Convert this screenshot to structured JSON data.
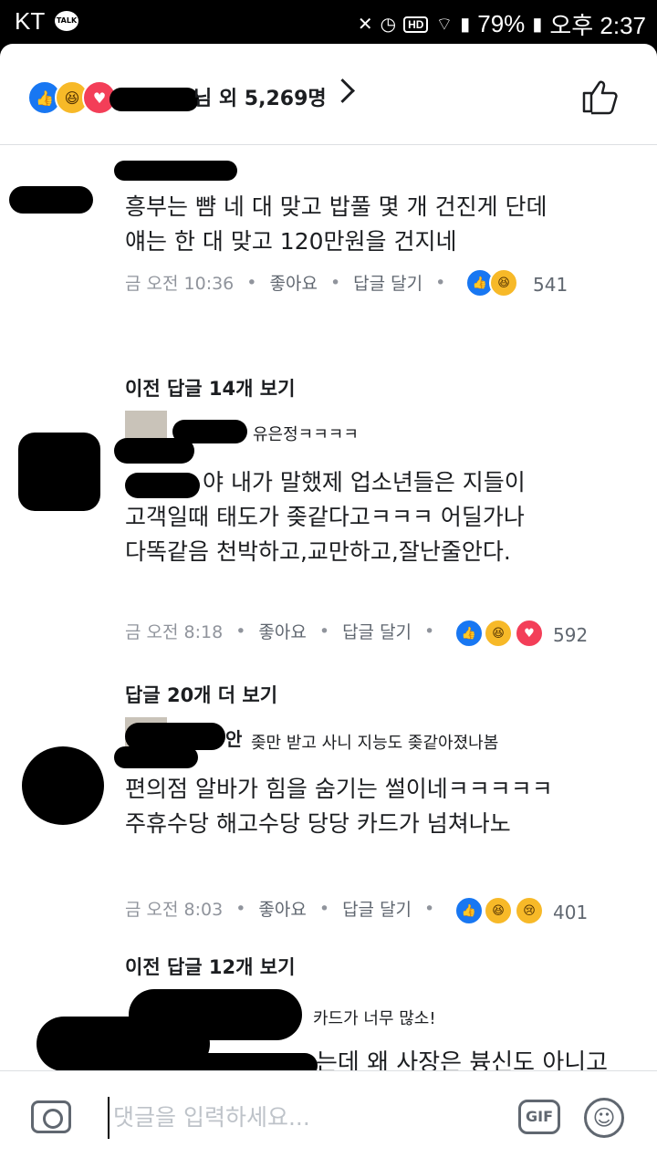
{
  "status": {
    "carrier": "KT",
    "talk_label": "TALK",
    "hd_label": "HD",
    "battery": "79%",
    "time": "오후 2:37"
  },
  "header": {
    "reactors_suffix": "님 외 5,269명"
  },
  "comments": [
    {
      "text": "흥부는 뺨 네 대 맞고 밥풀 몇 개 건진게 단데\n얘는 한 대 맞고 120만원을 건지네",
      "time": "금 오전 10:36",
      "like": "좋아요",
      "reply": "답글 달기",
      "reaction_count": "541",
      "reactions": [
        "like",
        "haha"
      ],
      "prev_replies": "이전 답글 14개 보기",
      "reply_text": "유은정ㅋㅋㅋㅋ"
    },
    {
      "text_lead": "야 내가 말했제 업소년들은 지들이",
      "text": "고객일때 태도가 좆같다고ㅋㅋㅋ 어딜가나\n다똑같음 천박하고,교만하고,잘난줄안다.",
      "time": "금 오전 8:18",
      "like": "좋아요",
      "reply": "답글 달기",
      "reaction_count": "592",
      "reactions": [
        "like",
        "haha",
        "love"
      ],
      "prev_replies": "답글 20개 더 보기",
      "reply_text": "좆만 받고 사니 지능도 좆같아졌나봄",
      "reply_name_tail": "안"
    },
    {
      "text": "편의점 알바가 힘을 숨기는 썰이네ㅋㅋㅋㅋㅋ\n주휴수당 해고수당 당당 카드가 넘쳐나노",
      "time": "금 오전 8:03",
      "like": "좋아요",
      "reply": "답글 달기",
      "reaction_count": "401",
      "reactions": [
        "like",
        "haha",
        "sad"
      ],
      "prev_replies": "이전 답글 12개 보기",
      "reply_text": "카드가 너무 많소!"
    },
    {
      "text": "는데 왜 사장은 븅신도 아니고"
    }
  ],
  "composer": {
    "placeholder": "댓글을 입력하세요...",
    "gif_label": "GIF"
  }
}
